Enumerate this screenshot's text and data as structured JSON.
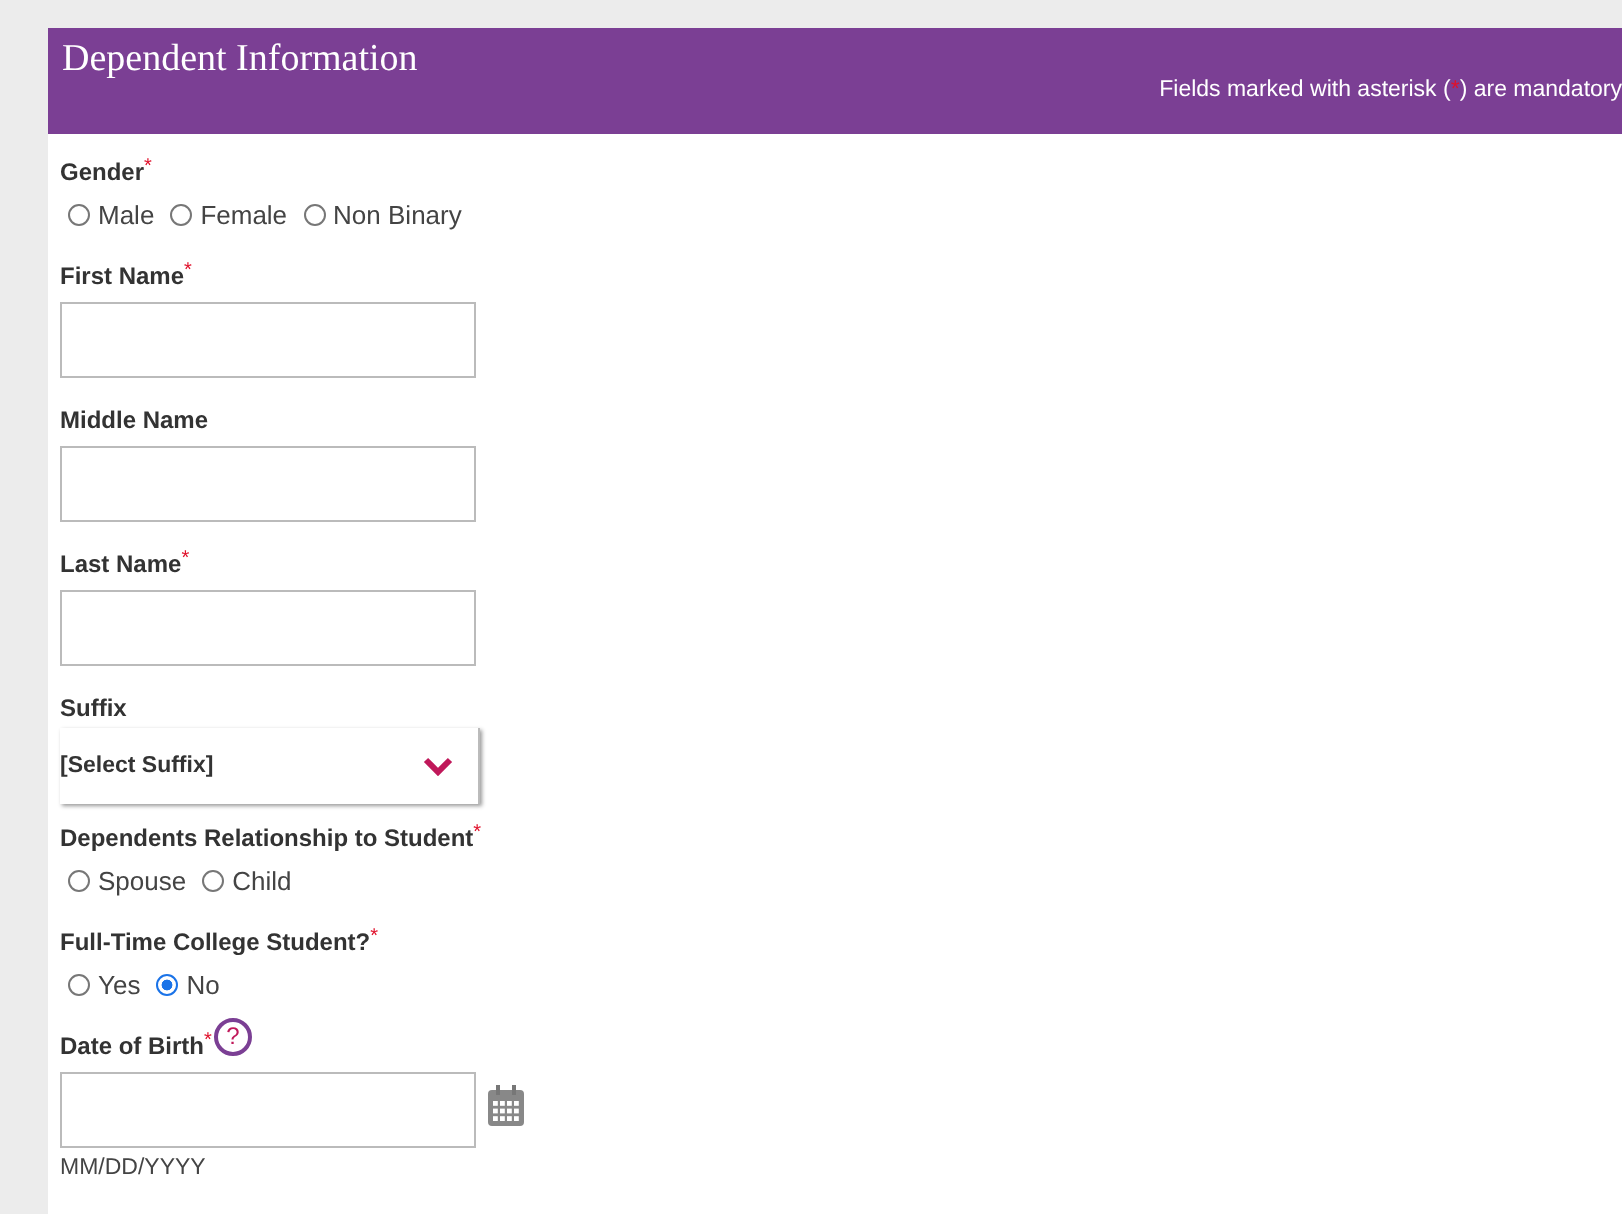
{
  "header": {
    "title": "Dependent Information",
    "note_before": "Fields marked with asterisk (",
    "note_mark": "*",
    "note_after": ") are mandatory"
  },
  "fields": [
    {
      "kind": "radio",
      "label": "Gender",
      "mark": "*",
      "options": [
        {
          "label": "Male",
          "selected": false
        },
        {
          "label": "Female",
          "selected": false
        },
        {
          "label": "Non Binary",
          "selected": false
        }
      ]
    },
    {
      "kind": "text",
      "label": "First Name",
      "mark": "*"
    },
    {
      "kind": "text",
      "label": "Middle Name"
    },
    {
      "kind": "text",
      "label": "Last Name",
      "mark": "*"
    },
    {
      "kind": "select",
      "label": "Suffix",
      "value": "[Select Suffix]"
    },
    {
      "kind": "radio",
      "label": "Dependents Relationship to Student",
      "mark": "*",
      "options": [
        {
          "label": "Spouse",
          "selected": false
        },
        {
          "label": "Child",
          "selected": false
        }
      ]
    },
    {
      "kind": "radio",
      "label": "Full-Time College Student?",
      "mark": "*",
      "options": [
        {
          "label": "Yes",
          "selected": false
        },
        {
          "label": "No",
          "selected": true
        }
      ]
    },
    {
      "kind": "date",
      "label": "Date of Birth",
      "mark": "*",
      "help": "?",
      "hint": "MM/DD/YYYY"
    }
  ]
}
